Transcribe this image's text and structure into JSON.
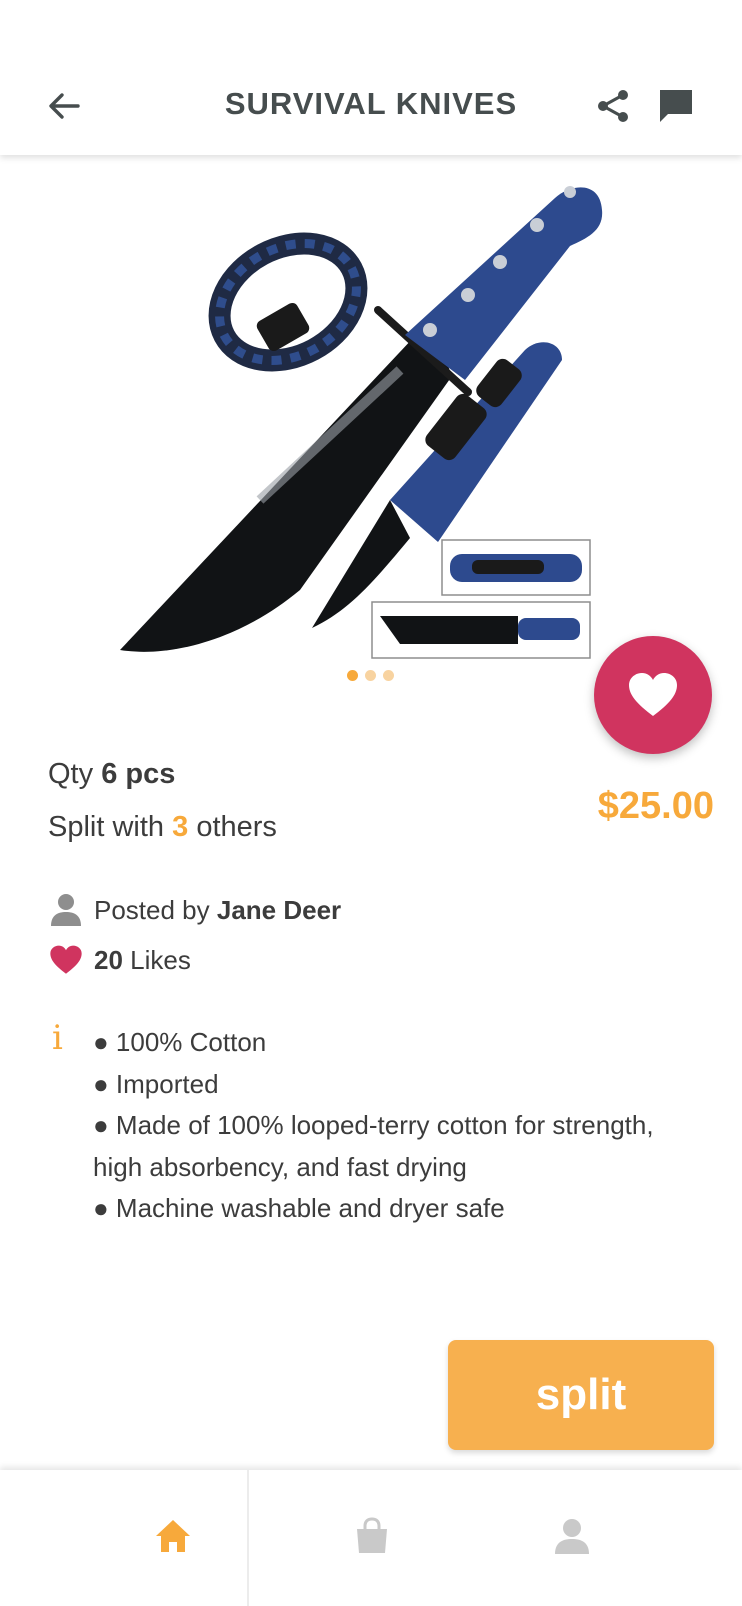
{
  "header": {
    "title": "SURVIVAL KNIVES"
  },
  "icons": {
    "back": "arrow-left-icon",
    "share": "share-icon",
    "chat": "chat-icon",
    "favorite": "heart-icon",
    "user": "person-icon",
    "likes": "heart-icon",
    "info": "info-icon",
    "nav_home": "home-icon",
    "nav_shop": "shopping-bag-icon",
    "nav_profile": "person-icon"
  },
  "colors": {
    "accent": "#f7a93b",
    "favorite": "#d0345f",
    "title": "#464d4e",
    "button": "#f7b04f",
    "nav_active": "#f7a93b",
    "nav_inactive": "#c9c9c9"
  },
  "carousel": {
    "total": 3,
    "active_index": 0
  },
  "product": {
    "qty_prefix": "Qty",
    "qty_value": "6 pcs",
    "split_prefix": "Split with",
    "split_count": "3",
    "split_suffix": "others",
    "price": "$25.00",
    "posted_prefix": "Posted by",
    "posted_by": "Jane Deer",
    "likes_count": "20",
    "likes_label": "Likes",
    "features": [
      "● 100% Cotton",
      "● Imported",
      "● Made of 100% looped-terry cotton for strength, high absorbency, and fast drying",
      "● Machine washable and dryer safe"
    ]
  },
  "actions": {
    "split_label": "split"
  },
  "nav": {
    "active": "home"
  }
}
